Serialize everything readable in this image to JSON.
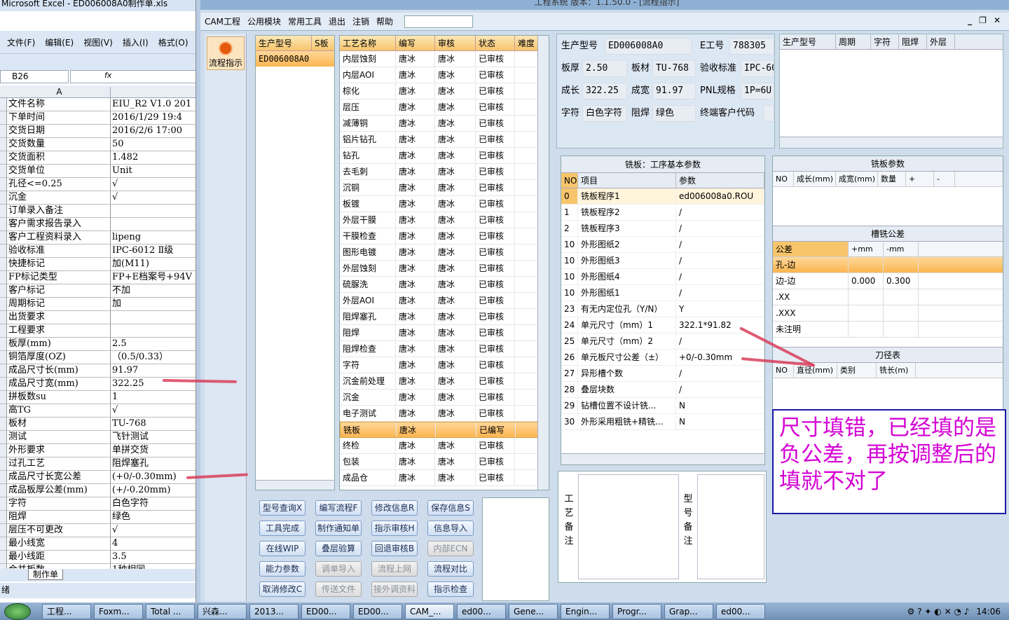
{
  "excel": {
    "title": "Microsoft Excel - ED006008A0制作单.xls",
    "menu": [
      "文件(F)",
      "编辑(E)",
      "视图(V)",
      "插入(I)",
      "格式(O)"
    ],
    "name_box": "B26",
    "fx_label": "fx",
    "col_a": "A",
    "rows": [
      [
        "文件名称",
        "EIU_R2 V1.0 201"
      ],
      [
        "下单时间",
        "2016/1/29 19:4"
      ],
      [
        "交货日期",
        "2016/2/6 17:00"
      ],
      [
        "交货数量",
        "50"
      ],
      [
        "交货面积",
        "1.482"
      ],
      [
        "交货单位",
        "Unit"
      ],
      [
        "孔径<=0.25",
        "√"
      ],
      [
        "沉金",
        "√"
      ],
      [
        "订单录入备注",
        ""
      ],
      [
        "客户需求报告录入",
        ""
      ],
      [
        "客户工程资料录入",
        "lipeng"
      ],
      [
        "验收标准",
        "IPC-6012 Ⅱ级"
      ],
      [
        "快捷标记",
        "加(M11)"
      ],
      [
        "FP标记类型",
        "FP+E档案号+94V"
      ],
      [
        "客户标记",
        "不加"
      ],
      [
        "周期标记",
        "加"
      ],
      [
        "出货要求",
        ""
      ],
      [
        "工程要求",
        ""
      ],
      [
        "板厚(mm)",
        "2.5"
      ],
      [
        "铜箔厚度(OZ)",
        "（0.5/0.33）"
      ],
      [
        "成品尺寸长(mm)",
        "91.97"
      ],
      [
        "成品尺寸宽(mm)",
        "322.25"
      ],
      [
        "拼板数su",
        "1"
      ],
      [
        "高TG",
        "√"
      ],
      [
        "板材",
        "TU-768"
      ],
      [
        "测试",
        "飞针测试"
      ],
      [
        "外形要求",
        "单拼交货"
      ],
      [
        "过孔工艺",
        "阻焊塞孔"
      ],
      [
        "成品尺寸长宽公差",
        "(+0/-0.30mm)"
      ],
      [
        "成品板厚公差(mm)",
        "(+/-0.20mm)"
      ],
      [
        "字符",
        "白色字符"
      ],
      [
        "阻焊",
        "绿色"
      ],
      [
        "层压不可更改",
        "√"
      ],
      [
        "最小线宽",
        "4"
      ],
      [
        "最小线距",
        "3.5"
      ],
      [
        "合并板数",
        "1种相同"
      ]
    ],
    "sheet_tab": "制作单",
    "status": "绪"
  },
  "cam": {
    "title": "工程系统   版本：1.1.50.0 - [流程指示]",
    "menu": [
      "CAM工程",
      "公用模块",
      "常用工具",
      "退出",
      "注销",
      "帮助"
    ],
    "left_button": "流程指示",
    "product_list": {
      "headers": [
        "生产型号",
        "S板"
      ],
      "selected": "ED006008A0"
    },
    "process_list": {
      "headers": [
        "工艺名称",
        "编写",
        "审核",
        "状态",
        "难度"
      ],
      "rows": [
        [
          "内层蚀刻",
          "唐冰",
          "唐冰",
          "已审核"
        ],
        [
          "内层AOI",
          "唐冰",
          "唐冰",
          "已审核"
        ],
        [
          "棕化",
          "唐冰",
          "唐冰",
          "已审核"
        ],
        [
          "层压",
          "唐冰",
          "唐冰",
          "已审核"
        ],
        [
          "减薄铜",
          "唐冰",
          "唐冰",
          "已审核"
        ],
        [
          "铝片钻孔",
          "唐冰",
          "唐冰",
          "已审核"
        ],
        [
          "钻孔",
          "唐冰",
          "唐冰",
          "已审核"
        ],
        [
          "去毛刺",
          "唐冰",
          "唐冰",
          "已审核"
        ],
        [
          "沉铜",
          "唐冰",
          "唐冰",
          "已审核"
        ],
        [
          "板镀",
          "唐冰",
          "唐冰",
          "已审核"
        ],
        [
          "外层干膜",
          "唐冰",
          "唐冰",
          "已审核"
        ],
        [
          "干膜检查",
          "唐冰",
          "唐冰",
          "已审核"
        ],
        [
          "图形电镀",
          "唐冰",
          "唐冰",
          "已审核"
        ],
        [
          "外层蚀刻",
          "唐冰",
          "唐冰",
          "已审核"
        ],
        [
          "硫脲洗",
          "唐冰",
          "唐冰",
          "已审核"
        ],
        [
          "外层AOI",
          "唐冰",
          "唐冰",
          "已审核"
        ],
        [
          "阻焊塞孔",
          "唐冰",
          "唐冰",
          "已审核"
        ],
        [
          "阻焊",
          "唐冰",
          "唐冰",
          "已审核"
        ],
        [
          "阻焊检查",
          "唐冰",
          "唐冰",
          "已审核"
        ],
        [
          "字符",
          "唐冰",
          "唐冰",
          "已审核"
        ],
        [
          "沉金前处理",
          "唐冰",
          "唐冰",
          "已审核"
        ],
        [
          "沉金",
          "唐冰",
          "唐冰",
          "已审核"
        ],
        [
          "电子测试",
          "唐冰",
          "唐冰",
          "已审核"
        ],
        [
          "铣板",
          "唐冰",
          "",
          "已编写"
        ],
        [
          "终检",
          "唐冰",
          "唐冰",
          "已审核"
        ],
        [
          "包装",
          "唐冰",
          "唐冰",
          "已审核"
        ],
        [
          "成品仓",
          "唐冰",
          "唐冰",
          "已审核"
        ]
      ]
    },
    "buttons": [
      [
        "型号查询X",
        "编写流程F",
        "修改信息R",
        "保存信息S"
      ],
      [
        "工具完成",
        "制作通知单",
        "指示审核H",
        "信息导入"
      ],
      [
        "在线WIP",
        "叠层验算",
        "回退审核B",
        "内部ECN"
      ],
      [
        "能力参数",
        "调单导入",
        "流程上网",
        "流程对比"
      ],
      [
        "取消修改C",
        "传送文件",
        "接外调资料",
        "指示检查"
      ]
    ],
    "info": {
      "model_label": "生产型号",
      "model": "ED006008A0",
      "eno_label": "E工号",
      "eno": "788305",
      "thick_label": "板厚",
      "thick": "2.50",
      "mat_label": "板材",
      "mat": "TU-768",
      "std_label": "验收标准",
      "std": "IPC-60",
      "len_label": "成长",
      "len": "322.25",
      "wid_label": "成宽",
      "wid": "91.97",
      "pnl_label": "PNL规格",
      "pnl": "1P=6U",
      "char_label": "字符",
      "char": "白色字符",
      "mask_label": "阻焊",
      "mask": "绿色",
      "cust_label": "终端客户代码",
      "cust": ""
    },
    "info_grid_headers": [
      "生产型号",
      "周期",
      "字符",
      "阻焊",
      "外层"
    ],
    "mill": {
      "title": "铣板：工序基本参数",
      "headers": [
        "NO",
        "项目",
        "参数"
      ],
      "rows": [
        [
          "0",
          "铣板程序1",
          "ed006008a0.ROU"
        ],
        [
          "1",
          "铣板程序2",
          "/"
        ],
        [
          "2",
          "铣板程序3",
          "/"
        ],
        [
          "10",
          "外形图纸2",
          "/"
        ],
        [
          "10",
          "外形图纸3",
          "/"
        ],
        [
          "10",
          "外形图纸4",
          "/"
        ],
        [
          "10",
          "外形图纸1",
          "/"
        ],
        [
          "23",
          "有无内定位孔（Y/N）",
          "Y"
        ],
        [
          "24",
          "单元尺寸（mm）1",
          "322.1*91.82"
        ],
        [
          "25",
          "单元尺寸（mm）2",
          "/"
        ],
        [
          "26",
          "单元板尺寸公差（±）",
          "+0/-0.30mm"
        ],
        [
          "27",
          "异形槽个数",
          "/"
        ],
        [
          "28",
          "叠层块数",
          "/"
        ],
        [
          "29",
          "钻槽位置不设计铣...",
          "N"
        ],
        [
          "30",
          "外形采用粗铣+精铣...",
          "N"
        ]
      ]
    },
    "mill_param": {
      "title": "铣板参数",
      "headers": [
        "NO",
        "成长(mm)",
        "成宽(mm)",
        "数量",
        "+",
        "-"
      ]
    },
    "slot_tol": {
      "title": "槽铣公差",
      "headers": [
        "公差",
        "+mm",
        "-mm"
      ],
      "rows": [
        [
          "孔-边",
          "",
          ""
        ],
        [
          "边-边",
          "0.000",
          "0.300"
        ],
        [
          ".XX",
          "",
          ""
        ],
        [
          ".XXX",
          "",
          ""
        ],
        [
          "未注明",
          "",
          ""
        ]
      ]
    },
    "tool_table": {
      "title": "刀径表",
      "headers": [
        "NO",
        "直径(mm)",
        "类别",
        "铣长(m)"
      ]
    },
    "notes": {
      "process_label": "工艺备注",
      "model_label": "型号备注"
    }
  },
  "annotation": "尺寸填错，已经填的是负公差，再按调整后的填就不对了",
  "taskbar": {
    "items": [
      "工程...",
      "Foxm...",
      "Total ...",
      "兴森...",
      "2013...",
      "ED00...",
      "ED00...",
      "CAM_...",
      "ed00...",
      "Gene...",
      "Engin...",
      "Progr...",
      "Grap...",
      "ed00..."
    ],
    "clock": "14:06"
  },
  "colors": {
    "annotation_text": "#d400d4",
    "annotation_border": "#1a1aa8",
    "arrow": "#d9405a",
    "selected_row": "#fbb550"
  }
}
